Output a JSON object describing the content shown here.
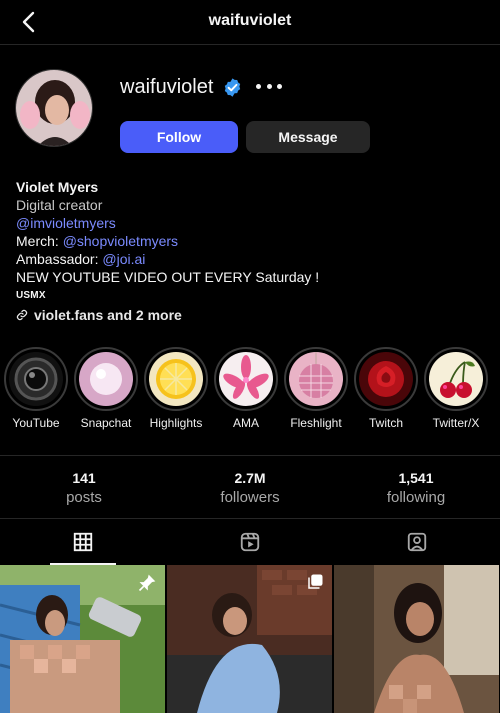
{
  "topbar": {
    "title": "waifuviolet"
  },
  "profile": {
    "username": "waifuviolet",
    "follow_label": "Follow",
    "message_label": "Message"
  },
  "bio": {
    "name": "Violet Myers",
    "category": "Digital creator",
    "handle": "@imvioletmyers",
    "merch_label": "Merch:",
    "merch_handle": "@shopvioletmyers",
    "ambassador_label": "Ambassador:",
    "ambassador_handle": "@joi.ai",
    "announcement": "NEW YOUTUBE VIDEO OUT EVERY Saturday !",
    "location": "USMX",
    "link_text": "violet.fans and 2 more"
  },
  "highlights": [
    {
      "label": "YouTube"
    },
    {
      "label": "Snapchat"
    },
    {
      "label": "Highlights"
    },
    {
      "label": "AMA"
    },
    {
      "label": "Fleshlight"
    },
    {
      "label": "Twitch"
    },
    {
      "label": "Twitter/X"
    }
  ],
  "stats": [
    {
      "value": "141",
      "label": "posts"
    },
    {
      "value": "2.7M",
      "label": "followers"
    },
    {
      "value": "1,541",
      "label": "following"
    }
  ],
  "colors": {
    "accent": "#4a5df9",
    "link": "#7b8bff",
    "verified": "#3897f0"
  }
}
